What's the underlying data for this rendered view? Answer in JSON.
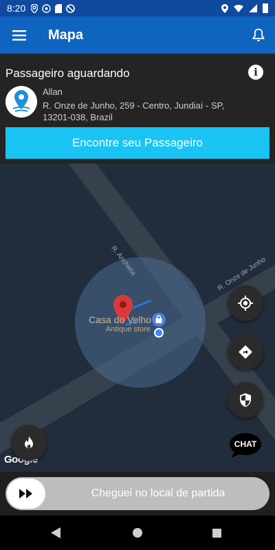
{
  "status_bar": {
    "time": "8:20",
    "left_icons": [
      "location-icon",
      "at-icon",
      "sd-card-icon",
      "no-sync-icon"
    ],
    "right_icons": [
      "location-icon",
      "wifi-icon",
      "signal-icon",
      "battery-icon"
    ]
  },
  "app_bar": {
    "title": "Mapa",
    "menu_icon": "hamburger-menu-icon",
    "bell_icon": "notification-bell-icon",
    "color": "#0f64c0"
  },
  "passenger_card": {
    "title": "Passageiro aguardando",
    "name": "Allan",
    "address": "R. Onze de Junho, 259 - Centro, Jundiaí - SP, 13201-038, Brazil",
    "find_button_label": "Encontre seu Passageiro",
    "find_button_color": "#19c4f4"
  },
  "map": {
    "road_labels": [
      "R. Anchieta",
      "R. Onze de Junho"
    ],
    "place_name": "Casa do Velho",
    "place_category": "Antique store",
    "attribution": "Google"
  },
  "floating_buttons": {
    "locate": "crosshair-locate-icon",
    "navigate": "directions-arrow-icon",
    "safety": "shield-icon",
    "heat": "flame-icon",
    "chat_label": "CHAT"
  },
  "slide_action": {
    "label": "Cheguei no local de partida",
    "knob_icon": "fast-forward-icon"
  },
  "nav_bar": {
    "icons": [
      "back-triangle-icon",
      "home-circle-icon",
      "recent-square-icon"
    ]
  }
}
